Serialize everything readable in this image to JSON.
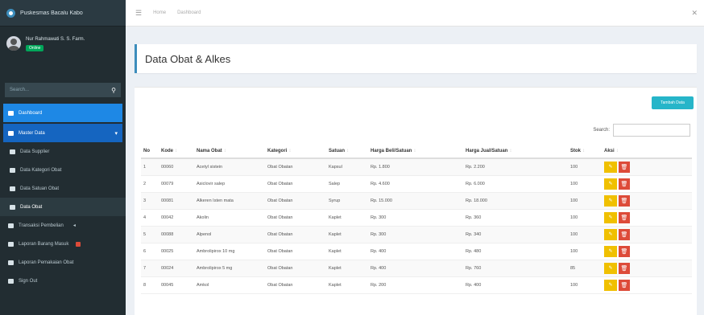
{
  "app": {
    "title": "Puskesmas Bacalu Kabo"
  },
  "user": {
    "name": "Nur Rahmawati S. S. Farm.",
    "status": "Online"
  },
  "sidebar": {
    "search_placeholder": "Search...",
    "items": [
      {
        "label": "Dashboard"
      },
      {
        "label": "Master Data"
      },
      {
        "label": "Data Supplier"
      },
      {
        "label": "Data Kategori Obat"
      },
      {
        "label": "Data Satuan Obat"
      },
      {
        "label": "Data Obat"
      },
      {
        "label": "Transaksi Pembelian"
      },
      {
        "label": "Laporan Barang Masuk"
      },
      {
        "label": "Laporan Pemakaian Obat"
      },
      {
        "label": "Sign Out"
      }
    ]
  },
  "topbar": {
    "crumb1": "Home",
    "crumb2": "Dashboard"
  },
  "page": {
    "title": "Data Obat & Alkes"
  },
  "toolbar": {
    "add_label": "Tambah Data",
    "search_label": "Search:",
    "search_value": ""
  },
  "table": {
    "headers": [
      "No",
      "Kode",
      "Nama Obat",
      "Kategori",
      "Satuan",
      "Harga Beli/Satuan",
      "Harga Jual/Satuan",
      "Stok",
      "Aksi"
    ],
    "rows": [
      [
        "1",
        "00060",
        "Acetyl sistein",
        "Obat Obatan",
        "Kapsul",
        "Rp. 1.800",
        "Rp. 2.200",
        "100"
      ],
      [
        "2",
        "00079",
        "Asiclovir salep",
        "Obat Obatan",
        "Salep",
        "Rp. 4.600",
        "Rp. 6.000",
        "100"
      ],
      [
        "3",
        "00081",
        "Alkeren Isten mata",
        "Obat Obatan",
        "Syrup",
        "Rp. 15.000",
        "Rp. 18.000",
        "100"
      ],
      [
        "4",
        "00042",
        "Akolin",
        "Obat Obatan",
        "Kaplet",
        "Rp. 300",
        "Rp. 360",
        "100"
      ],
      [
        "5",
        "00088",
        "Alpenol",
        "Obat Obatan",
        "Kaplet",
        "Rp. 300",
        "Rp. 340",
        "100"
      ],
      [
        "6",
        "00025",
        "Ambrolipirox 10 mg",
        "Obat Obatan",
        "Kaplet",
        "Rp. 400",
        "Rp. 480",
        "100"
      ],
      [
        "7",
        "00024",
        "Ambrolipirox 5 mg",
        "Obat Obatan",
        "Kaplet",
        "Rp. 400",
        "Rp. 760",
        "85"
      ],
      [
        "8",
        "00045",
        "Amkol",
        "Obat Obatan",
        "Kaplet",
        "Rp. 200",
        "Rp. 400",
        "100"
      ]
    ]
  }
}
